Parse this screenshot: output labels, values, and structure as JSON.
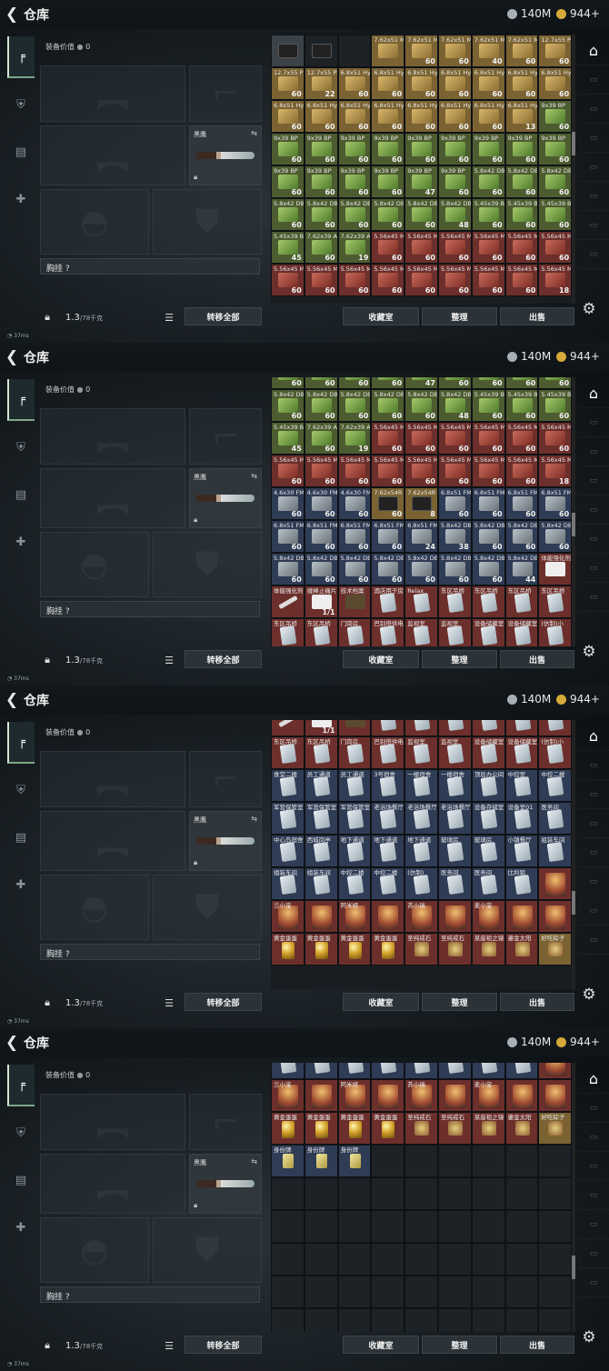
{
  "header": {
    "title": "仓库",
    "silver": "140M",
    "gold": "944+"
  },
  "left": {
    "equip_value_label": "装备价值",
    "equip_value": "0",
    "knife_name": "黑鹰",
    "chest_label": "胸挂",
    "chest_help": "?",
    "weight": "1.3",
    "weight_max": "/78千克",
    "transfer_all": "转移全部"
  },
  "buttons": {
    "collection": "收藏室",
    "sort": "整理",
    "sell": "出售"
  },
  "status": {
    "ping": "37ms"
  },
  "colors": {
    "gold_coin": "#d6a93a",
    "silver_coin": "#a8b0b6",
    "accent_tab": "#7fa58a"
  },
  "rows": {
    "a": [
      [
        "",
        "",
        "gray",
        "i-case"
      ],
      [
        "",
        null,
        "dark",
        "i-case"
      ],
      [
        "",
        "",
        "dark",
        ""
      ],
      [
        "7.62x51 M61",
        "",
        "gold",
        "i-ammo"
      ],
      [
        "7.62x51 M62",
        "60",
        "gold",
        "i-ammo"
      ],
      [
        "7.62x51 M80",
        "60",
        "gold",
        "i-ammo"
      ],
      [
        "7.62x51 M80",
        "40",
        "gold",
        "i-ammo"
      ],
      [
        "7.62x51 M80",
        "60",
        "gold",
        "i-ammo"
      ],
      [
        "12.7x55 PS12B",
        "60",
        "gold",
        "i-ammo"
      ]
    ],
    "b": [
      [
        "12.7x55 PS12A",
        "60",
        "gold",
        "i-ammo"
      ],
      [
        "12.7x55 PS12",
        "22",
        "gold",
        "i-ammo"
      ],
      [
        "6.8x51 Hybrid",
        "60",
        "gold",
        "i-ammo"
      ],
      [
        "6.8x51 Hybrid",
        "60",
        "gold",
        "i-ammo"
      ],
      [
        "6.8x51 Hybrid",
        "60",
        "gold",
        "i-ammo"
      ],
      [
        "6.8x51 Hybrid",
        "60",
        "gold",
        "i-ammo"
      ],
      [
        "6.8x51 Hybrid",
        "60",
        "gold",
        "i-ammo"
      ],
      [
        "6.8x51 Hybrid",
        "60",
        "gold",
        "i-ammo"
      ],
      [
        "6.8x51 Hybrid",
        "60",
        "gold",
        "i-ammo"
      ]
    ],
    "c": [
      [
        "6.8x51 Hybrid",
        "60",
        "gold",
        "i-ammo"
      ],
      [
        "6.8x51 Hybrid",
        "60",
        "gold",
        "i-ammo"
      ],
      [
        "6.8x51 Hybrid",
        "60",
        "gold",
        "i-ammo"
      ],
      [
        "6.8x51 Hybrid",
        "60",
        "gold",
        "i-ammo"
      ],
      [
        "6.8x51 Hybrid",
        "60",
        "gold",
        "i-ammo"
      ],
      [
        "6.8x51 Hybrid",
        "60",
        "gold",
        "i-ammo"
      ],
      [
        "6.8x51 Hybrid",
        "60",
        "gold",
        "i-ammo"
      ],
      [
        "6.8x51 Hybrid",
        "13",
        "gold",
        "i-ammo"
      ],
      [
        "9x39 BP",
        "60",
        "green",
        "i-greenbox"
      ]
    ],
    "d": [
      [
        "9x39 BP",
        "60",
        "green",
        "i-greenbox"
      ],
      [
        "9x39 BP",
        "60",
        "green",
        "i-greenbox"
      ],
      [
        "9x39 BP",
        "60",
        "green",
        "i-greenbox"
      ],
      [
        "9x39 BP",
        "60",
        "green",
        "i-greenbox"
      ],
      [
        "9x39 BP",
        "60",
        "green",
        "i-greenbox"
      ],
      [
        "9x39 BP",
        "60",
        "green",
        "i-greenbox"
      ],
      [
        "9x39 BP",
        "60",
        "green",
        "i-greenbox"
      ],
      [
        "9x39 BP",
        "60",
        "green",
        "i-greenbox"
      ],
      [
        "9x39 BP",
        "60",
        "green",
        "i-greenbox"
      ]
    ],
    "e": [
      [
        "9x39 BP",
        "60",
        "green",
        "i-greenbox"
      ],
      [
        "9x39 BP",
        "60",
        "green",
        "i-greenbox"
      ],
      [
        "9x39 BP",
        "60",
        "green",
        "i-greenbox"
      ],
      [
        "9x39 BP",
        "60",
        "green",
        "i-greenbox"
      ],
      [
        "9x39 BP",
        "47",
        "green",
        "i-greenbox"
      ],
      [
        "9x39 BP",
        "60",
        "green",
        "i-greenbox"
      ],
      [
        "5.8x42 DBP10",
        "60",
        "green",
        "i-greenbox"
      ],
      [
        "5.8x42 DBP10",
        "60",
        "green",
        "i-greenbox"
      ],
      [
        "5.8x42 DBP10",
        "60",
        "green",
        "i-greenbox"
      ]
    ],
    "f": [
      [
        "5.8x42 DBP10",
        "60",
        "green",
        "i-greenbox"
      ],
      [
        "5.8x42 DBP10",
        "60",
        "green",
        "i-greenbox"
      ],
      [
        "5.8x42 DBP10",
        "60",
        "green",
        "i-greenbox"
      ],
      [
        "5.8x42 DBP10",
        "60",
        "green",
        "i-greenbox"
      ],
      [
        "5.8x42 DBP10",
        "60",
        "green",
        "i-greenbox"
      ],
      [
        "5.8x42 DBP10",
        "48",
        "green",
        "i-greenbox"
      ],
      [
        "5.45x39 BS",
        "60",
        "green",
        "i-greenbox"
      ],
      [
        "5.45x39 BS",
        "60",
        "green",
        "i-greenbox"
      ],
      [
        "5.45x39 BS",
        "60",
        "green",
        "i-greenbox"
      ]
    ],
    "g": [
      [
        "5.45x39 BS",
        "45",
        "green",
        "i-greenbox"
      ],
      [
        "7.62x39 AP",
        "60",
        "green",
        "i-greenbox"
      ],
      [
        "7.62x39 AP",
        "19",
        "green",
        "i-greenbox"
      ],
      [
        "5.56x45 M855",
        "60",
        "red",
        "i-redbox"
      ],
      [
        "5.56x45 M855",
        "60",
        "red",
        "i-redbox"
      ],
      [
        "5.56x45 M855",
        "60",
        "red",
        "i-redbox"
      ],
      [
        "5.56x45 M855",
        "60",
        "red",
        "i-redbox"
      ],
      [
        "5.56x45 M855",
        "60",
        "red",
        "i-redbox"
      ],
      [
        "5.56x45 M855",
        "60",
        "red",
        "i-redbox"
      ]
    ],
    "h": [
      [
        "5.56x45 M855",
        "60",
        "red",
        "i-redbox"
      ],
      [
        "5.56x45 M855",
        "60",
        "red",
        "i-redbox"
      ],
      [
        "5.56x45 M855",
        "60",
        "red",
        "i-redbox"
      ],
      [
        "5.56x45 M855",
        "60",
        "red",
        "i-redbox"
      ],
      [
        "5.56x45 M855",
        "60",
        "red",
        "i-redbox"
      ],
      [
        "5.56x45 M855",
        "60",
        "red",
        "i-redbox"
      ],
      [
        "5.56x45 M855",
        "60",
        "red",
        "i-redbox"
      ],
      [
        "5.56x45 M855",
        "60",
        "red",
        "i-redbox"
      ],
      [
        "5.56x45 M855",
        "18",
        "red",
        "i-redbox"
      ]
    ],
    "i": [
      [
        "4.6x30 FMJ SX",
        "60",
        "blue",
        "i-silverbox"
      ],
      [
        "4.6x30 FMJ SX",
        "60",
        "blue",
        "i-silverbox"
      ],
      [
        "4.6x30 FMJ SX",
        "60",
        "blue",
        "i-silverbox"
      ],
      [
        "7.62x54R LPS",
        "60",
        "gold",
        "i-case"
      ],
      [
        "7.62x54R LPS",
        "8",
        "gold",
        "i-case"
      ],
      [
        "6.8x51 FMJ",
        "60",
        "blue",
        "i-silverbox"
      ],
      [
        "6.8x51 FMJ",
        "60",
        "blue",
        "i-silverbox"
      ],
      [
        "6.8x51 FMJ",
        "60",
        "blue",
        "i-silverbox"
      ],
      [
        "6.8x51 FMJ",
        "60",
        "blue",
        "i-silverbox"
      ]
    ],
    "j": [
      [
        "6.8x51 FMJ",
        "60",
        "blue",
        "i-silverbox"
      ],
      [
        "6.8x51 FMJ",
        "60",
        "blue",
        "i-silverbox"
      ],
      [
        "6.8x51 FMJ",
        "60",
        "blue",
        "i-silverbox"
      ],
      [
        "6.8x51 FMJ",
        "60",
        "blue",
        "i-silverbox"
      ],
      [
        "6.8x51 FMJ",
        "24",
        "blue",
        "i-silverbox"
      ],
      [
        "5.8x42 DBP10",
        "38",
        "blue",
        "i-silverbox"
      ],
      [
        "5.8x42 DBP10",
        "60",
        "blue",
        "i-silverbox"
      ],
      [
        "5.8x42 DBP10",
        "60",
        "blue",
        "i-silverbox"
      ],
      [
        "5.8x42 DBP10",
        "60",
        "blue",
        "i-silverbox"
      ]
    ],
    "k": [
      [
        "5.8x42 DBP10",
        "60",
        "blue",
        "i-silverbox"
      ],
      [
        "5.8x42 DBP10",
        "60",
        "blue",
        "i-silverbox"
      ],
      [
        "5.8x42 DBP10",
        "60",
        "blue",
        "i-silverbox"
      ],
      [
        "5.8x42 DBP10",
        "60",
        "blue",
        "i-silverbox"
      ],
      [
        "5.8x42 DBP10",
        "60",
        "blue",
        "i-silverbox"
      ],
      [
        "5.8x42 DBP10",
        "60",
        "blue",
        "i-silverbox"
      ],
      [
        "5.8x42 DBP10",
        "60",
        "blue",
        "i-silverbox"
      ],
      [
        "5.8x42 DBP10",
        "44",
        "blue",
        "i-silverbox"
      ],
      [
        "体能强化剂",
        "",
        "red",
        "i-pill"
      ]
    ],
    "l": [
      [
        "体能强化剂",
        "",
        "red",
        "i-knife"
      ],
      [
        "缠棒止痛片",
        "1/1",
        "red",
        "i-pill"
      ],
      [
        "技术档案",
        "",
        "red",
        "i-bag"
      ],
      [
        "酒店用于房卡",
        "",
        "red",
        "i-card"
      ],
      [
        "Relax",
        "",
        "red",
        "i-card"
      ],
      [
        "东区吊桥",
        "",
        "red",
        "i-card"
      ],
      [
        "东区吊桥",
        "",
        "red",
        "i-card"
      ],
      [
        "东区吊桥",
        "",
        "red",
        "i-card"
      ],
      [
        "东区吊桥",
        "",
        "red",
        "i-card"
      ]
    ],
    "m": [
      [
        "东区吊桥",
        "",
        "red",
        "i-card"
      ],
      [
        "东区吊桥",
        "",
        "red",
        "i-card"
      ],
      [
        "门岗房",
        "",
        "red",
        "i-card"
      ],
      [
        "巴别塔供电",
        "",
        "red",
        "i-card"
      ],
      [
        "监视室",
        "",
        "red",
        "i-card"
      ],
      [
        "监视室",
        "",
        "red",
        "i-card"
      ],
      [
        "设备储藏室",
        "",
        "red",
        "i-card"
      ],
      [
        "设备储藏室",
        "",
        "red",
        "i-card"
      ],
      [
        "(仿制)小",
        "",
        "red",
        "i-card"
      ]
    ],
    "n": [
      [
        "食堂二楼",
        "",
        "blue",
        "i-card"
      ],
      [
        "员工通道",
        "",
        "blue",
        "i-card"
      ],
      [
        "员工通道",
        "",
        "blue",
        "i-card"
      ],
      [
        "3号宿舍",
        "",
        "blue",
        "i-card"
      ],
      [
        "一楼宿舍",
        "",
        "blue",
        "i-card"
      ],
      [
        "一楼宿舍",
        "",
        "blue",
        "i-card"
      ],
      [
        "顶层办公间",
        "",
        "blue",
        "i-card"
      ],
      [
        "中控室",
        "",
        "blue",
        "i-card"
      ],
      [
        "中控二楼",
        "",
        "blue",
        "i-card"
      ]
    ],
    "o": [
      [
        "军营保管室",
        "",
        "blue",
        "i-card"
      ],
      [
        "军营保管室",
        "",
        "blue",
        "i-card"
      ],
      [
        "军营保管室",
        "",
        "blue",
        "i-card"
      ],
      [
        "老浴场餐厅",
        "",
        "blue",
        "i-card"
      ],
      [
        "老浴场餐厅",
        "",
        "blue",
        "i-card"
      ],
      [
        "老浴场餐厅",
        "",
        "blue",
        "i-card"
      ],
      [
        "设备存储室",
        "",
        "blue",
        "i-card"
      ],
      [
        "设备室01",
        "",
        "blue",
        "i-card"
      ],
      [
        "医务间",
        "",
        "blue",
        "i-card"
      ]
    ],
    "p": [
      [
        "中心岛宿舍",
        "",
        "blue",
        "i-card"
      ],
      [
        "西城岗亭",
        "",
        "blue",
        "i-card"
      ],
      [
        "地下通道",
        "",
        "blue",
        "i-card"
      ],
      [
        "地下通道",
        "",
        "blue",
        "i-card"
      ],
      [
        "地下通道",
        "",
        "blue",
        "i-card"
      ],
      [
        "玻璃房",
        "",
        "blue",
        "i-card"
      ],
      [
        "玻璃房",
        "",
        "blue",
        "i-card"
      ],
      [
        "小镇餐厅",
        "",
        "blue",
        "i-card"
      ],
      [
        "组装车间",
        "",
        "blue",
        "i-card"
      ]
    ],
    "q": [
      [
        "组装车间",
        "",
        "blue",
        "i-card"
      ],
      [
        "组装车间",
        "",
        "blue",
        "i-card"
      ],
      [
        "中控二楼",
        "",
        "blue",
        "i-card"
      ],
      [
        "中控二楼",
        "",
        "blue",
        "i-card"
      ],
      [
        "(仿制)",
        "",
        "blue",
        "i-card"
      ],
      [
        "医务间",
        "",
        "blue",
        "i-card"
      ],
      [
        "医务间",
        "",
        "blue",
        "i-card"
      ],
      [
        "比利狼",
        "",
        "blue",
        "i-card"
      ],
      [
        "",
        "",
        "red",
        "i-figure"
      ]
    ],
    "r": [
      [
        "兰小宝",
        "",
        "red",
        "i-figure"
      ],
      [
        "",
        "",
        "red",
        "i-figure"
      ],
      [
        "阿米娅",
        "",
        "red",
        "i-figure"
      ],
      [
        "",
        "",
        "red",
        "i-figure"
      ],
      [
        "苏小瑞",
        "",
        "red",
        "i-figure"
      ],
      [
        "",
        "",
        "red",
        "i-figure"
      ],
      [
        "麦小宝",
        "",
        "red",
        "i-figure"
      ],
      [
        "",
        "",
        "red",
        "i-figure"
      ],
      [
        "",
        "",
        "red",
        "i-figure"
      ]
    ],
    "s": [
      [
        "黄金蛋蛋",
        "",
        "red",
        "i-egg"
      ],
      [
        "黄金蛋蛋",
        "",
        "red",
        "i-egg"
      ],
      [
        "黄金蛋蛋",
        "",
        "red",
        "i-egg"
      ],
      [
        "黄金蛋蛋",
        "",
        "red",
        "i-egg"
      ],
      [
        "至纯戒石",
        "",
        "red",
        "i-jewel"
      ],
      [
        "至纯戒石",
        "",
        "red",
        "i-jewel"
      ],
      [
        "某座祖之镜",
        "",
        "red",
        "i-jewel"
      ],
      [
        "鎏金太阳",
        "",
        "red",
        "i-jewel"
      ],
      [
        "好吃粽子",
        "",
        "gold",
        "i-jewel"
      ]
    ],
    "t": [
      [
        "身份牌",
        "",
        "blue",
        "i-tag"
      ],
      [
        "身份牌",
        "",
        "blue",
        "i-tag"
      ],
      [
        "身份牌",
        "",
        "blue",
        "i-tag"
      ],
      [
        "",
        "",
        "dark",
        ""
      ],
      [
        "",
        "",
        "dark",
        ""
      ],
      [
        "",
        "",
        "dark",
        ""
      ],
      [
        "",
        "",
        "dark",
        ""
      ],
      [
        "",
        "",
        "dark",
        ""
      ],
      [
        "",
        "",
        "dark",
        ""
      ]
    ]
  },
  "panels": [
    {
      "start": "a",
      "rows": [
        "a",
        "b",
        "c",
        "d",
        "e",
        "f",
        "g",
        "h"
      ],
      "offset": 0,
      "sbtop": 136
    },
    {
      "rows": [
        "e",
        "f",
        "g",
        "h",
        "i",
        "j",
        "k",
        "l",
        "m"
      ],
      "offset": -23,
      "sbtop": 190
    },
    {
      "rows": [
        "l",
        "m",
        "n",
        "o",
        "p",
        "q",
        "r",
        "s"
      ],
      "offset": -18,
      "sbtop": 240
    },
    {
      "rows": [
        "q",
        "r",
        "s",
        "t"
      ],
      "offset": -18,
      "sbtop": 270
    }
  ]
}
